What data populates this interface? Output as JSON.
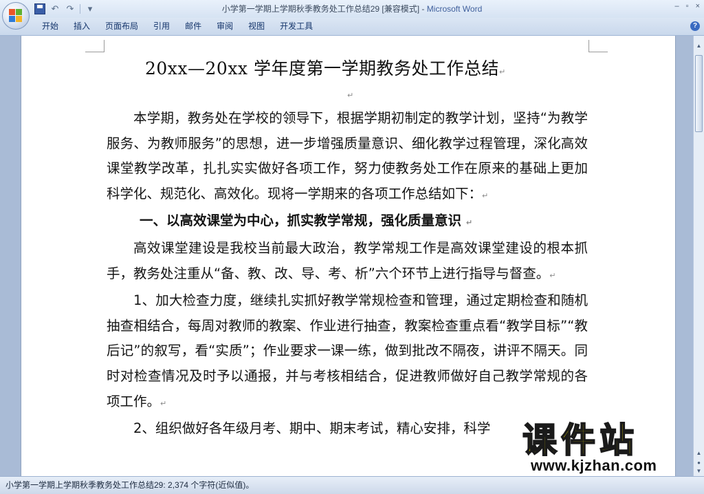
{
  "window": {
    "doc_name": "小学第一学期上学期秋季教务处工作总结29 [兼容模式] - ",
    "app_name": "Microsoft Word",
    "controls": [
      "–",
      "▫",
      "×"
    ]
  },
  "qat": {
    "save_icon": "save-icon",
    "undo_icon": "undo-icon",
    "redo_icon": "redo-icon"
  },
  "ribbon": {
    "tabs": [
      "开始",
      "插入",
      "页面布局",
      "引用",
      "邮件",
      "审阅",
      "视图",
      "开发工具"
    ],
    "help_label": "?"
  },
  "document": {
    "title": "20xx—20xx 学年度第一学期教务处工作总结",
    "paragraph_mark": "↵",
    "paragraphs": [
      "本学期，教务处在学校的领导下，根据学期初制定的教学计划，坚持“为教学服务、为教师服务”的思想，进一步增强质量意识、细化教学过程管理，深化高效课堂教学改革，扎扎实实做好各项工作，努力使教务处工作在原来的基础上更加科学化、规范化、高效化。现将一学期来的各项工作总结如下：",
      "一、以高效课堂为中心，抓实教学常规，强化质量意识",
      "高效课堂建设是我校当前最大政治，教学常规工作是高效课堂建设的根本抓手，教务处注重从“备、教、改、导、考、析”六个环节上进行指导与督查。",
      "1、加大检查力度，继续扎实抓好教学常规检查和管理，通过定期检查和随机抽查相结合，每周对教师的教案、作业进行抽查，教案检查重点看“教学目标”“教后记”的叙写，看“实质”；作业要求一课一练，做到批改不隔夜，讲评不隔天。同时对检查情况及时予以通报，并与考核相结合，促进教师做好自己教学常规的各项工作。",
      "2、组织做好各年级月考、期中、期末考试，精心安排，科学"
    ]
  },
  "watermark": {
    "text": "课件站",
    "url": "www.kjzhan.com"
  },
  "status": {
    "text": "小学第一学期上学期秋季教务处工作总结29: 2,374 个字符(近似值)。"
  }
}
